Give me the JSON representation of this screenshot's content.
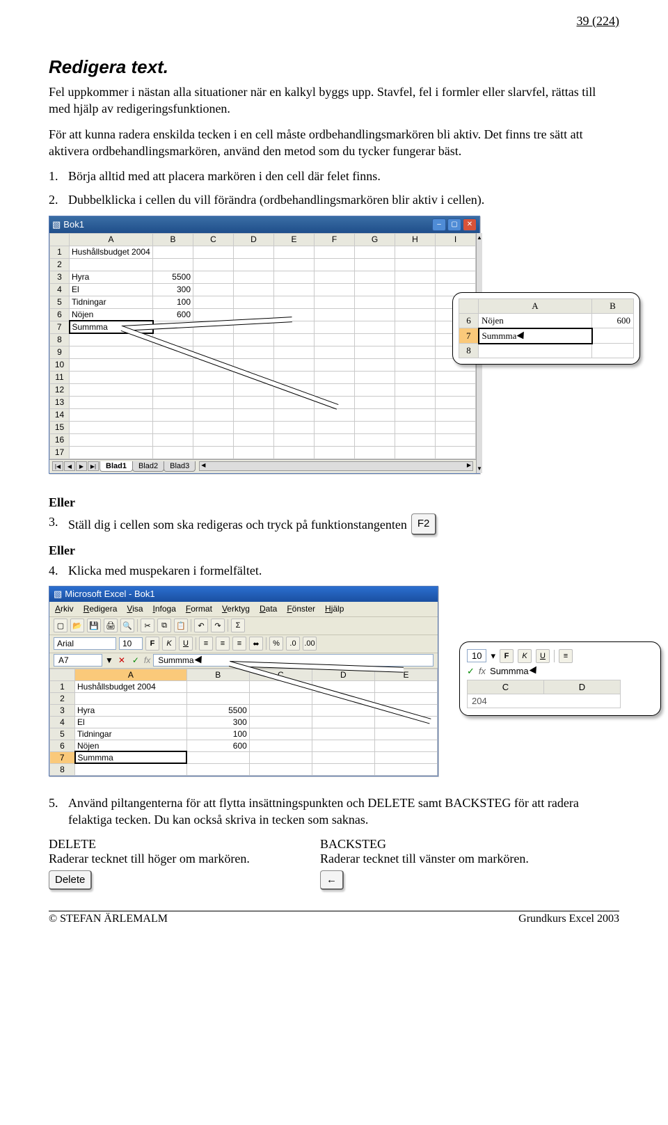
{
  "page": {
    "top_number": "39 (224)",
    "footer_left": "© STEFAN ÄRLEMALM",
    "footer_right": "Grundkurs Excel 2003"
  },
  "heading": "Redigera text.",
  "intro1": "Fel uppkommer i nästan alla situationer när en kalkyl byggs upp. Stavfel, fel i formler eller slarvfel, rättas till med hjälp av redigeringsfunktionen.",
  "intro2": "För att kunna radera enskilda tecken i en cell måste ordbehandlingsmarkören bli aktiv. Det finns tre sätt att aktivera ordbehandlingsmarkören, använd den metod som du tycker fungerar bäst.",
  "step1": "Börja alltid med att placera markören i den cell där felet finns.",
  "step2": "Dubbelklicka i cellen du vill förändra (ordbehandlingsmarkören blir aktiv i cellen).",
  "eller": "Eller",
  "step3": "Ställ dig i cellen som ska redigeras och tryck på funktionstangenten",
  "f2": "F2",
  "step4": "Klicka med muspekaren i formelfältet.",
  "step5_a": "Använd piltangenterna för att flytta insättningspunkten och ",
  "step5_b": "DELETE",
  "step5_c": " samt ",
  "step5_d": "BACKSTEG",
  "step5_e": " för att radera felaktiga tecken. Du kan också skriva in tecken som saknas.",
  "deleteCol": {
    "title": "DELETE",
    "desc": "Raderar tecknet till höger om markören.",
    "keylabel": "Delete"
  },
  "backCol": {
    "title": "BACKSTEG",
    "desc": "Raderar tecknet till vänster om markören.",
    "keylabel": "←"
  },
  "ss1": {
    "title": "Bok1",
    "cols": [
      "",
      "A",
      "B",
      "C",
      "D",
      "E",
      "F",
      "G",
      "H",
      "I"
    ],
    "rows": [
      {
        "n": "1",
        "a": "Hushållsbudget 2004"
      },
      {
        "n": "2",
        "a": ""
      },
      {
        "n": "3",
        "a": "Hyra",
        "b": "5500"
      },
      {
        "n": "4",
        "a": "El",
        "b": "300"
      },
      {
        "n": "5",
        "a": "Tidningar",
        "b": "100"
      },
      {
        "n": "6",
        "a": "Nöjen",
        "b": "600"
      },
      {
        "n": "7",
        "a": "Summma",
        "edit": true
      },
      {
        "n": "8"
      },
      {
        "n": "9"
      },
      {
        "n": "10"
      },
      {
        "n": "11"
      },
      {
        "n": "12"
      },
      {
        "n": "13"
      },
      {
        "n": "14"
      },
      {
        "n": "15"
      },
      {
        "n": "16"
      },
      {
        "n": "17"
      }
    ],
    "sheets": [
      "Blad1",
      "Blad2",
      "Blad3"
    ]
  },
  "callout1": {
    "cols": [
      "",
      "A",
      "B"
    ],
    "r6": {
      "n": "6",
      "a": "Nöjen",
      "b": "600"
    },
    "r7": {
      "n": "7",
      "a": "Summma"
    },
    "r8": {
      "n": "8"
    }
  },
  "ss2": {
    "title": "Microsoft Excel - Bok1",
    "menus": [
      "Arkiv",
      "Redigera",
      "Visa",
      "Infoga",
      "Format",
      "Verktyg",
      "Data",
      "Fönster",
      "Hjälp"
    ],
    "font": "Arial",
    "size": "10",
    "cellref": "A7",
    "formula": "Summma",
    "cols": [
      "",
      "A",
      "B",
      "C",
      "D",
      "E"
    ],
    "rows": [
      {
        "n": "1",
        "a": "Hushållsbudget 2004"
      },
      {
        "n": "2",
        "a": ""
      },
      {
        "n": "3",
        "a": "Hyra",
        "b": "5500"
      },
      {
        "n": "4",
        "a": "El",
        "b": "300"
      },
      {
        "n": "5",
        "a": "Tidningar",
        "b": "100"
      },
      {
        "n": "6",
        "a": "Nöjen",
        "b": "600"
      },
      {
        "n": "7",
        "a": "Summma",
        "edit": true,
        "hl": true
      },
      {
        "n": "8"
      }
    ]
  },
  "callout2": {
    "size": "10",
    "btnF": "F",
    "btnK": "K",
    "btnU": "U",
    "fx": "fx",
    "val": "Summma",
    "cols": [
      "C",
      "D"
    ]
  }
}
